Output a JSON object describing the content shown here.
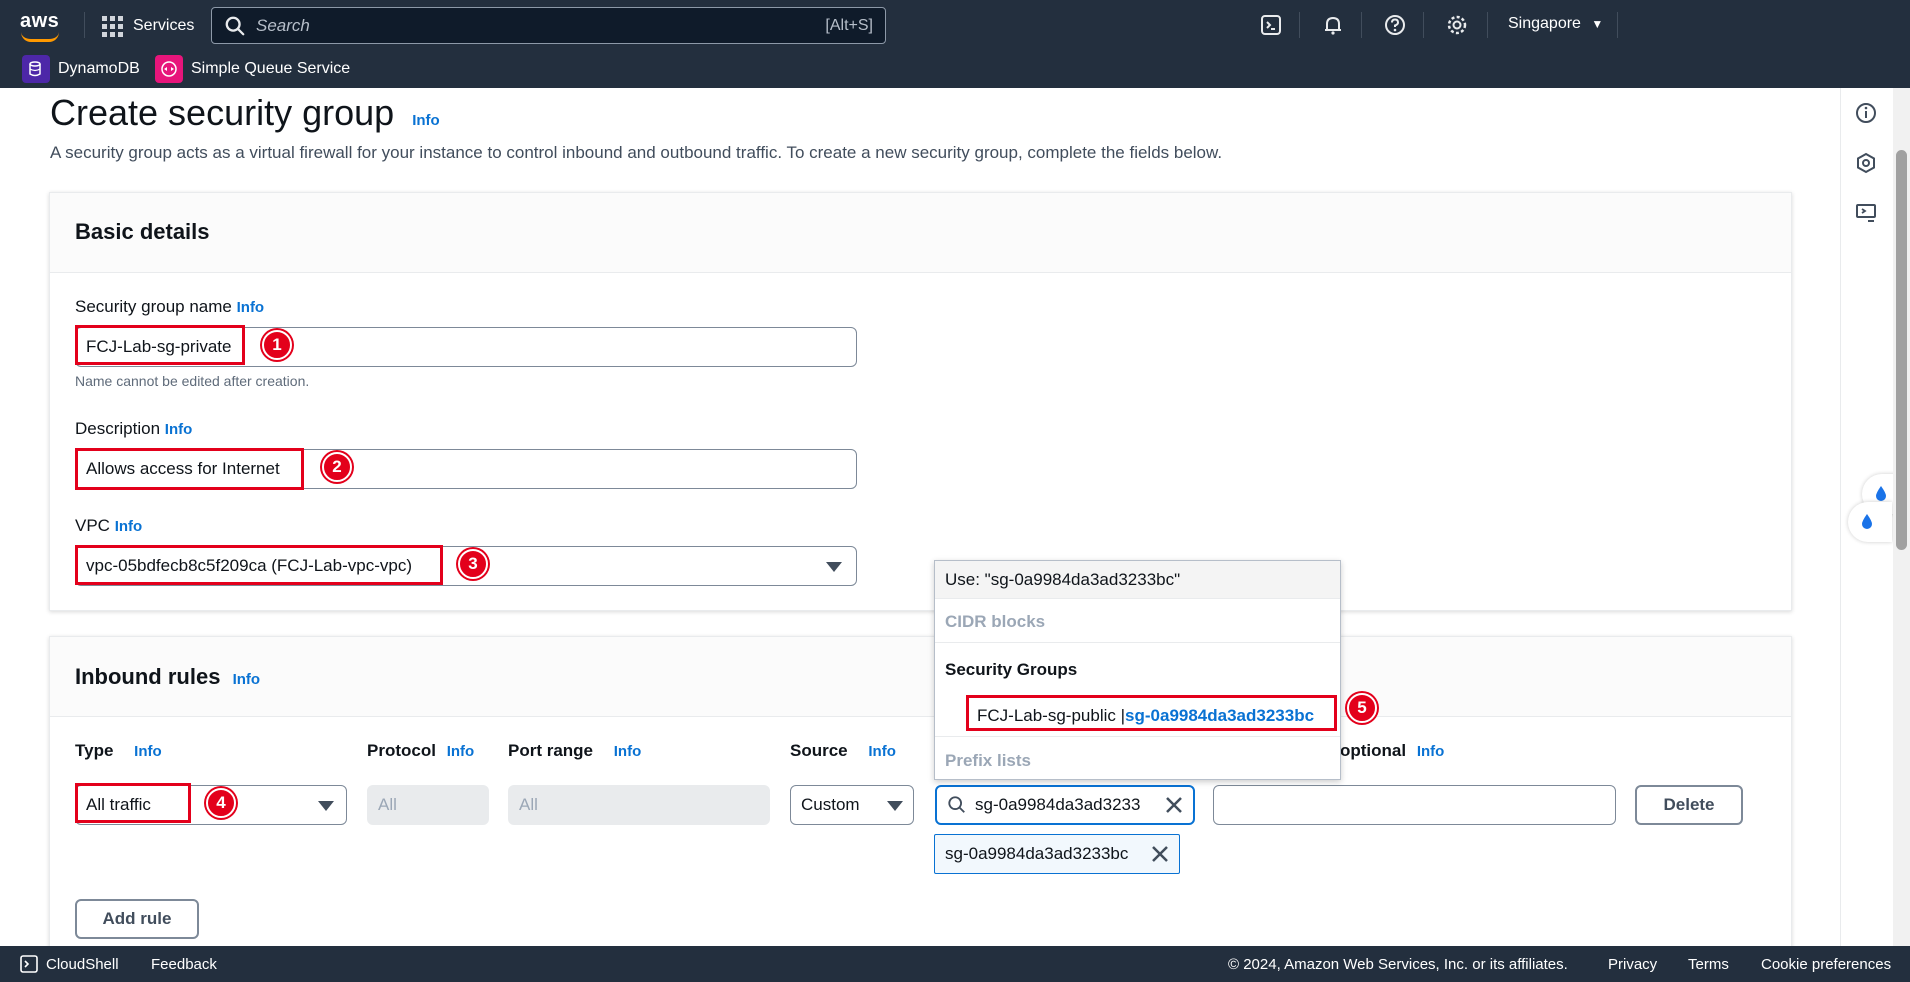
{
  "topnav": {
    "logo_text": "aws",
    "services_label": "Services",
    "search_placeholder": "Search",
    "search_shortcut": "[Alt+S]",
    "region": "Singapore"
  },
  "favorites": [
    {
      "label": "DynamoDB",
      "icon": "dynamodb-icon",
      "color": "#4d27a8"
    },
    {
      "label": "Simple Queue Service",
      "icon": "sqs-icon",
      "color": "#e7157b"
    }
  ],
  "page": {
    "title": "Create security group",
    "info": "Info",
    "description": "A security group acts as a virtual firewall for your instance to control inbound and outbound traffic. To create a new security group, complete the fields below."
  },
  "basic_details": {
    "title": "Basic details",
    "name_label": "Security group name",
    "name_info": "Info",
    "name_value": "FCJ-Lab-sg-private",
    "name_hint": "Name cannot be edited after creation.",
    "desc_label": "Description",
    "desc_info": "Info",
    "desc_value": "Allows access for Internet",
    "vpc_label": "VPC",
    "vpc_info": "Info",
    "vpc_value": "vpc-05bdfecb8c5f209ca (FCJ-Lab-vpc-vpc)"
  },
  "inbound": {
    "title": "Inbound rules",
    "info": "Info",
    "columns": {
      "type": "Type",
      "protocol": "Protocol",
      "port_range": "Port range",
      "source": "Source",
      "description_tail": "optional",
      "info": "Info"
    },
    "row": {
      "type": "All traffic",
      "protocol": "All",
      "port_range": "All",
      "source": "Custom",
      "search_value": "sg-0a9984da3ad3233",
      "token": "sg-0a9984da3ad3233bc",
      "delete": "Delete"
    },
    "add_rule": "Add rule"
  },
  "dropdown": {
    "use_text": "Use: \"sg-0a9984da3ad3233bc\"",
    "group_cidr": "CIDR blocks",
    "group_sg": "Security Groups",
    "option_name": "FCJ-Lab-sg-public | ",
    "option_id": "sg-0a9984da3ad3233bc",
    "group_prefix": "Prefix lists"
  },
  "badges": [
    "1",
    "2",
    "3",
    "4",
    "5"
  ],
  "footer": {
    "cloudshell": "CloudShell",
    "feedback": "Feedback",
    "copyright": "© 2024, Amazon Web Services, Inc. or its affiliates.",
    "privacy": "Privacy",
    "terms": "Terms",
    "cookies": "Cookie preferences"
  },
  "colors": {
    "nav_bg": "#232f3e",
    "link": "#0972d3",
    "annotation": "#e3001b",
    "aws_orange": "#ff9900"
  }
}
